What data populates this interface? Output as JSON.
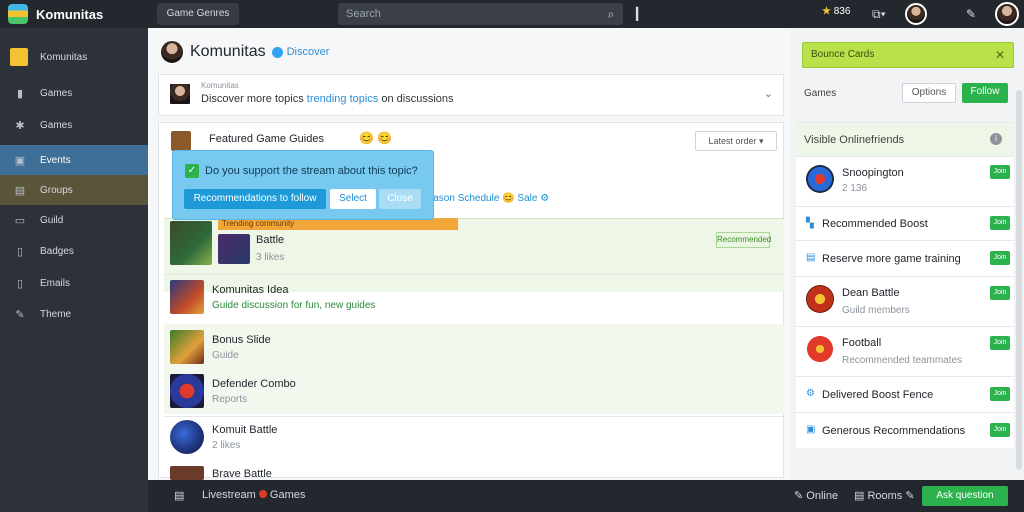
{
  "topbar": {
    "brand": "Komunitas",
    "menu_label": "Game Genres",
    "search_placeholder": "Search",
    "star_count": "836"
  },
  "sidebar": {
    "brand_label": "Komunitas",
    "items": [
      {
        "label": "Games",
        "icon": "gamepad-icon"
      },
      {
        "label": "Games",
        "icon": "puzzle-icon"
      },
      {
        "label": "Events",
        "icon": "calendar-icon"
      },
      {
        "label": "Groups",
        "icon": "group-icon"
      },
      {
        "label": "Guild",
        "icon": "guild-icon"
      },
      {
        "label": "Badges",
        "icon": "badge-icon"
      },
      {
        "label": "Emails",
        "icon": "mail-icon"
      },
      {
        "label": "Theme",
        "icon": "brush-icon"
      }
    ]
  },
  "main": {
    "title": "Komunitas",
    "title_link": "Discover",
    "composer_hint": "Komunitas",
    "composer_text": "Discover more topics",
    "composer_link": "trending topics",
    "composer_suffix": "on discussions",
    "post_author": "Featured Game Guides",
    "sort_label": "Latest order",
    "popup_question": "Do you support the stream about this topic?",
    "popup_btn_main": "Recommendations to follow",
    "popup_btn_ok": "Select",
    "popup_btn_close": "Close",
    "post_tail": "Season Schedule",
    "post_tail_emoji": "Sale",
    "banner_strip": "Trending community",
    "feed": [
      {
        "title": "Battle",
        "sub": "3 likes",
        "badge": "Recommended"
      },
      {
        "title": "Komunitas Idea",
        "sub": "Guide discussion for fun, new guides"
      },
      {
        "title": "Bonus Slide",
        "sub": "Guide"
      },
      {
        "title": "Defender Combo",
        "sub": "Reports"
      },
      {
        "title": "Komuit Battle",
        "sub": "2 likes"
      },
      {
        "title": "Brave Battle",
        "sub": ""
      }
    ]
  },
  "right": {
    "banner": "Bounce Cards",
    "header_label": "Games",
    "btn_secondary": "Options",
    "btn_primary": "Follow",
    "panel_title": "Visible Onlinefriends",
    "items": [
      {
        "name": "Snoopington",
        "sub": "2 136",
        "pill": "Join"
      },
      {
        "name": "Recommended Boost",
        "pill": "Join"
      },
      {
        "name": "Reserve more game training",
        "pill": "Join"
      },
      {
        "name": "Dean Battle",
        "sub": "Guild members",
        "pill": "Join"
      },
      {
        "name": "Football",
        "sub": "Recommended teammates",
        "pill": "Join"
      },
      {
        "name": "Delivered Boost Fence",
        "pill": "Join"
      },
      {
        "name": "Generous Recommendations",
        "pill": "Join"
      }
    ]
  },
  "bottombar": {
    "status": "Livestream",
    "status_game": "Games",
    "status_right": "Online",
    "status_right2": "Rooms",
    "send_label": "Ask question"
  },
  "colors": {
    "accent": "#2bb24c",
    "link": "#2b8fd9",
    "banner": "#b9e24a"
  }
}
